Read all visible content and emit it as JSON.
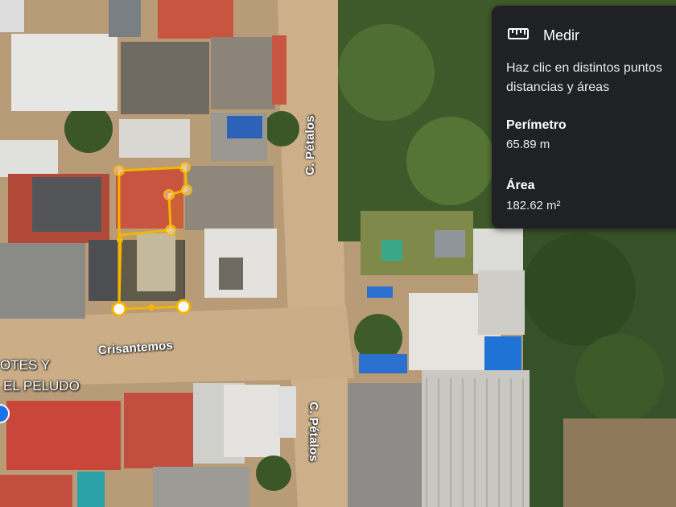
{
  "map": {
    "streets": [
      {
        "id": "c-petalos-north",
        "label": "C. Pétalos"
      },
      {
        "id": "crisantemos",
        "label": "Crisantemos"
      },
      {
        "id": "c-petalos-south",
        "label": "C. Pétalos"
      }
    ],
    "poi_lines": [
      "OTES Y",
      "EL PELUDO"
    ]
  },
  "measure_panel": {
    "icon": "ruler-icon",
    "title": "Medir",
    "instructions": "Haz clic en distintos puntos distancias y áreas",
    "perimeter_label": "Perímetro",
    "perimeter_value": "65.89 m",
    "area_label": "Área",
    "area_value": "182.62 m²"
  },
  "colors": {
    "measure_line": "#f4b400",
    "panel_bg": "#202124",
    "poi_marker": "#1a73e8"
  }
}
